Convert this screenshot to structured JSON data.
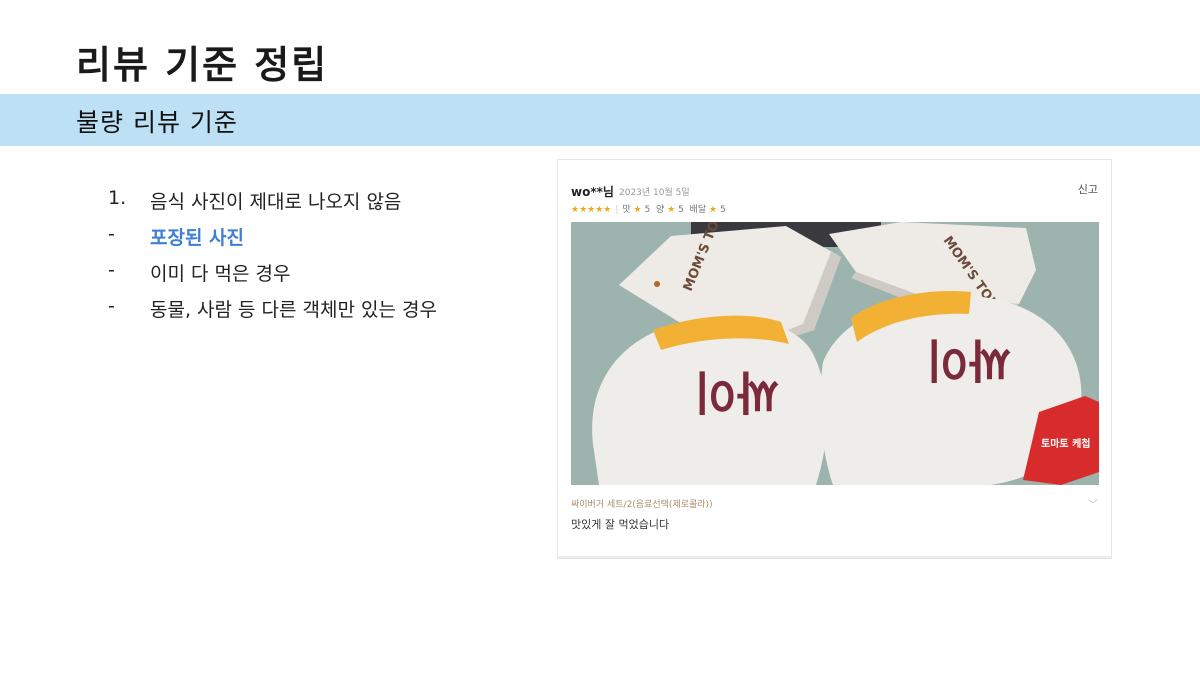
{
  "page": {
    "title": "리뷰 기준 정립",
    "subtitle": "불량 리뷰 기준"
  },
  "criteria": [
    {
      "marker": "1.",
      "text": "음식 사진이 제대로 나오지 않음",
      "highlight": false
    },
    {
      "marker": "-",
      "text": "포장된 사진",
      "highlight": true
    },
    {
      "marker": "-",
      "text": "이미 다 먹은 경우",
      "highlight": false
    },
    {
      "marker": "-",
      "text": "동물, 사람 등 다른 객체만 있는 경우",
      "highlight": false
    }
  ],
  "review": {
    "user": "wo**님",
    "date": "2023년 10월 5일",
    "report_label": "신고",
    "stars": "★★★★★",
    "taste_label": "맛",
    "taste_score": "5",
    "amount_label": "양",
    "amount_score": "5",
    "delivery_label": "배달",
    "delivery_score": "5",
    "photo": {
      "wrapper_text": "MOM'S TOUCH",
      "burger_text": "싸이",
      "sauce_text": "토마토 케첩"
    },
    "menu": "싸이버거 세트/2(음료선택(제로콜라))",
    "text": "맛있게 잘 먹었습니다"
  },
  "colors": {
    "band": "#bde0f4",
    "highlight": "#3d7fd6",
    "star": "#f0a81e"
  }
}
